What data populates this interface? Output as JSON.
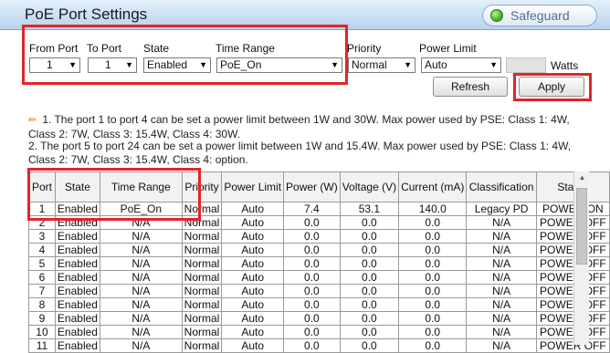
{
  "header": {
    "title": "PoE Port Settings",
    "safeguard": "Safeguard"
  },
  "form": {
    "from_port": {
      "label": "From Port",
      "value": "1"
    },
    "to_port": {
      "label": "To Port",
      "value": "1"
    },
    "state": {
      "label": "State",
      "value": "Enabled"
    },
    "time_range": {
      "label": "Time Range",
      "value": "PoE_On"
    },
    "priority": {
      "label": "Priority",
      "value": "Normal"
    },
    "power_limit": {
      "label": "Power Limit",
      "value": "Auto",
      "unit": "Watts"
    },
    "refresh_label": "Refresh",
    "apply_label": "Apply"
  },
  "notes": [
    "1. The port 1 to port 4 can be set a power limit between 1W and 30W. Max power used by PSE: Class 1: 4W, Class 2: 7W, Class 3: 15.4W, Class 4: 30W.",
    "2. The port 5 to port 24 can be set a power limit between 1W and 15.4W. Max power used by PSE: Class 1: 4W, Class 2: 7W, Class 3: 15.4W, Class 4: option."
  ],
  "table": {
    "headers": [
      "Port",
      "State",
      "Time Range",
      "Priority",
      "Power Limit",
      "Power (W)",
      "Voltage (V)",
      "Current (mA)",
      "Classification",
      "Status"
    ],
    "rows": [
      [
        "1",
        "Enabled",
        "PoE_On",
        "Normal",
        "Auto",
        "7.4",
        "53.1",
        "140.0",
        "Legacy PD",
        "POWER ON"
      ],
      [
        "2",
        "Enabled",
        "N/A",
        "Normal",
        "Auto",
        "0.0",
        "0.0",
        "0.0",
        "N/A",
        "POWER OFF"
      ],
      [
        "3",
        "Enabled",
        "N/A",
        "Normal",
        "Auto",
        "0.0",
        "0.0",
        "0.0",
        "N/A",
        "POWER OFF"
      ],
      [
        "4",
        "Enabled",
        "N/A",
        "Normal",
        "Auto",
        "0.0",
        "0.0",
        "0.0",
        "N/A",
        "POWER OFF"
      ],
      [
        "5",
        "Enabled",
        "N/A",
        "Normal",
        "Auto",
        "0.0",
        "0.0",
        "0.0",
        "N/A",
        "POWER OFF"
      ],
      [
        "6",
        "Enabled",
        "N/A",
        "Normal",
        "Auto",
        "0.0",
        "0.0",
        "0.0",
        "N/A",
        "POWER OFF"
      ],
      [
        "7",
        "Enabled",
        "N/A",
        "Normal",
        "Auto",
        "0.0",
        "0.0",
        "0.0",
        "N/A",
        "POWER OFF"
      ],
      [
        "8",
        "Enabled",
        "N/A",
        "Normal",
        "Auto",
        "0.0",
        "0.0",
        "0.0",
        "N/A",
        "POWER OFF"
      ],
      [
        "9",
        "Enabled",
        "N/A",
        "Normal",
        "Auto",
        "0.0",
        "0.0",
        "0.0",
        "N/A",
        "POWER OFF"
      ],
      [
        "10",
        "Enabled",
        "N/A",
        "Normal",
        "Auto",
        "0.0",
        "0.0",
        "0.0",
        "N/A",
        "POWER OFF"
      ],
      [
        "11",
        "Enabled",
        "N/A",
        "Normal",
        "Auto",
        "0.0",
        "0.0",
        "0.0",
        "N/A",
        "POWER OFF"
      ]
    ]
  },
  "colors": {
    "header_bg": "#c8dff3",
    "highlight": "#e3242b",
    "status_ok": "#3ca020"
  },
  "icons": {
    "status": "green-status-dot",
    "note": "pencil-icon",
    "scroll": "scroll-up-arrow-icon"
  }
}
